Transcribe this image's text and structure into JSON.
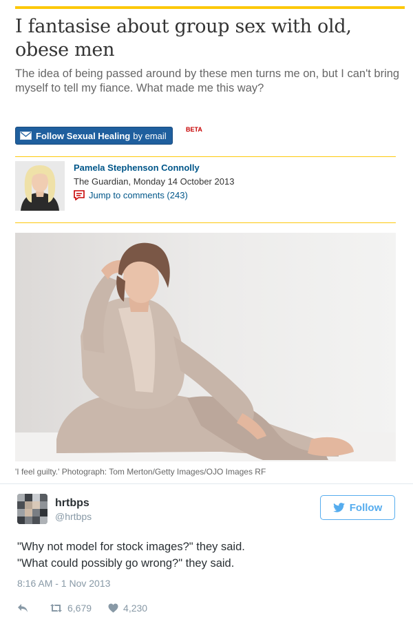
{
  "article": {
    "headline": "I fantasise about group sex with old, obese men",
    "standfirst": "The idea of being passed around by these men turns me on, but I can't bring myself to tell my fiance. What made me this way?",
    "follow_button": {
      "strong": "Follow Sexual Healing",
      "light": "by email",
      "icon": "mail-icon"
    },
    "badge": "BETA",
    "author": "Pamela Stephenson Connolly",
    "dateline": "The Guardian, Monday 14 October 2013",
    "comments_link": "Jump to comments (243)",
    "caption": "'I feel guilty.' Photograph: Tom Merton/Getty Images/OJO Images RF",
    "accent_color": "#fdc80a",
    "link_color": "#005689"
  },
  "tweet": {
    "name": "hrtbps",
    "handle": "@hrtbps",
    "follow_label": "Follow",
    "lines": [
      "\"Why not model for stock images?\" they said.",
      "\"What could possibly go wrong?\" they said."
    ],
    "timestamp": "8:16 AM - 1 Nov 2013",
    "retweets": "6,679",
    "likes": "4,230",
    "icons": [
      "reply-icon",
      "retweet-icon",
      "heart-icon"
    ],
    "accent_color": "#55acee"
  }
}
